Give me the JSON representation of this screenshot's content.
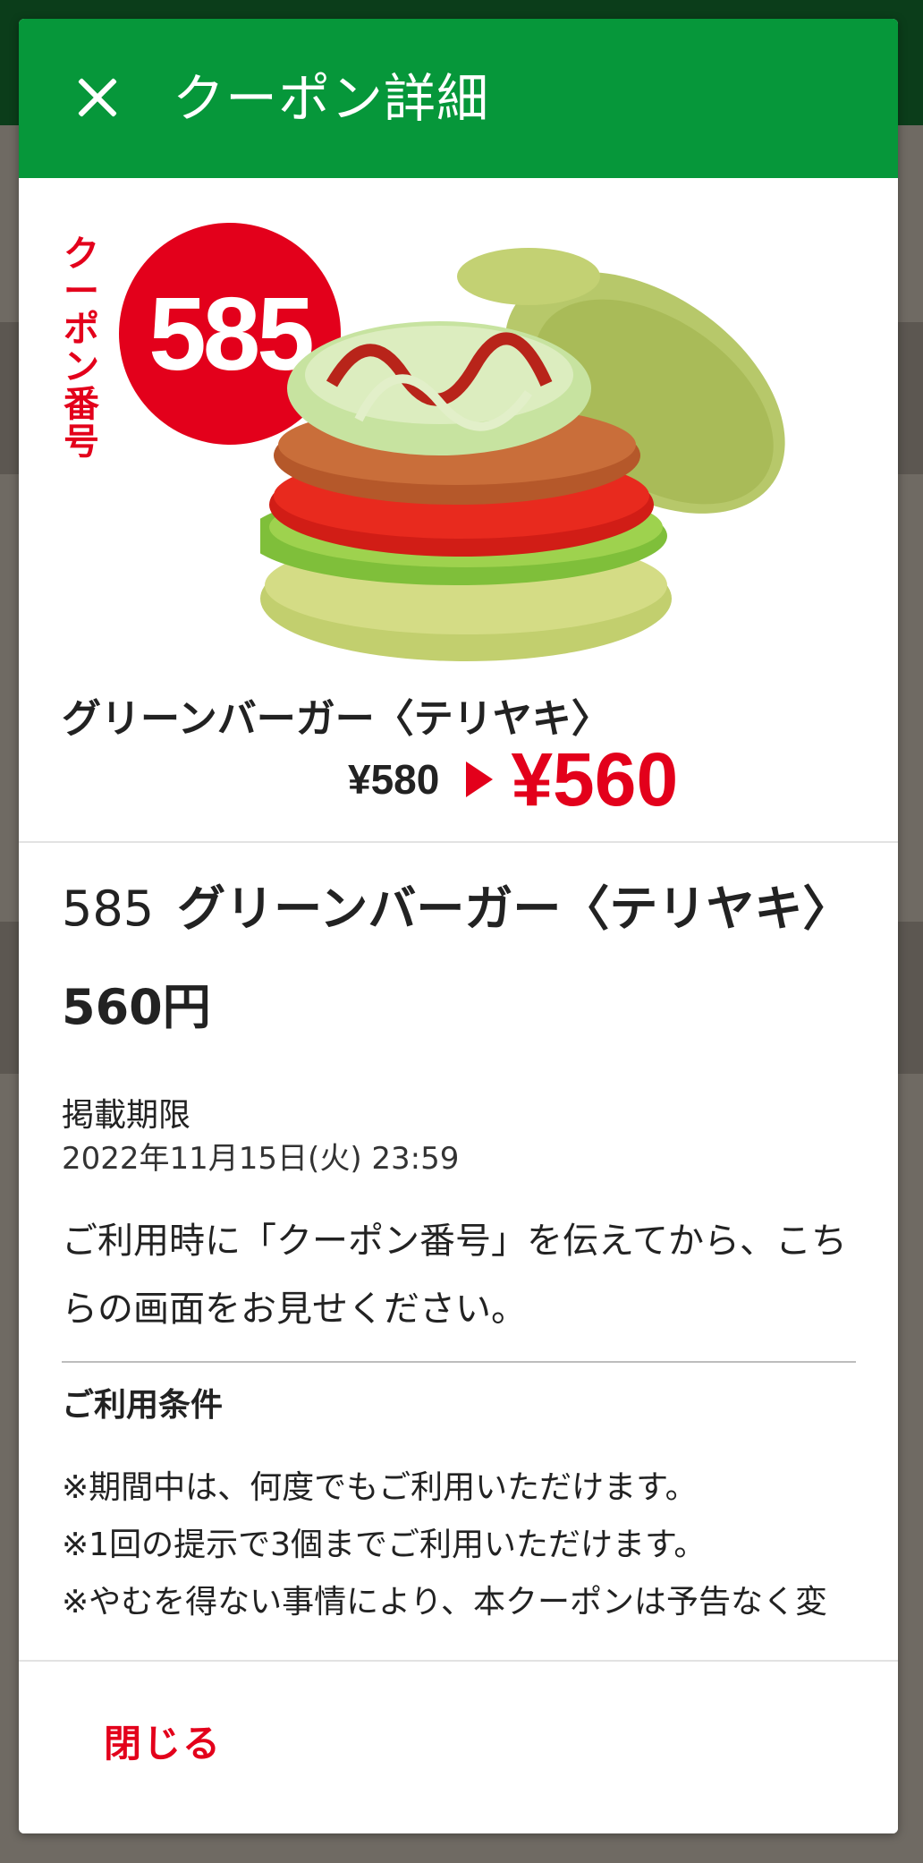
{
  "header": {
    "title": "クーポン詳細",
    "close_icon": "close-icon"
  },
  "hero": {
    "coupon_label": "クーポン番号",
    "coupon_number": "585",
    "product_name": "グリーンバーガー〈テリヤキ〉",
    "old_price": "¥580",
    "new_price": "¥560",
    "image": "burger-image"
  },
  "detail": {
    "heading_number": "585",
    "heading_text": "グリーンバーガー〈テリヤキ〉 560円",
    "period_label": "掲載期限",
    "period_value": "2022年11月15日(火) 23:59",
    "instructions": "ご利用時に「クーポン番号」を伝えてから、こちらの画面をお見せください。",
    "terms_title": "ご利用条件",
    "terms": [
      "※期間中は、何度でもご利用いただけます。",
      "※1回の提示で3個までご利用いただけます。",
      "※やむを得ない事情により、本クーポンは予告なく変"
    ]
  },
  "footer": {
    "close_label": "閉じる"
  },
  "colors": {
    "brand_green": "#06973a",
    "accent_red": "#e3001b"
  }
}
